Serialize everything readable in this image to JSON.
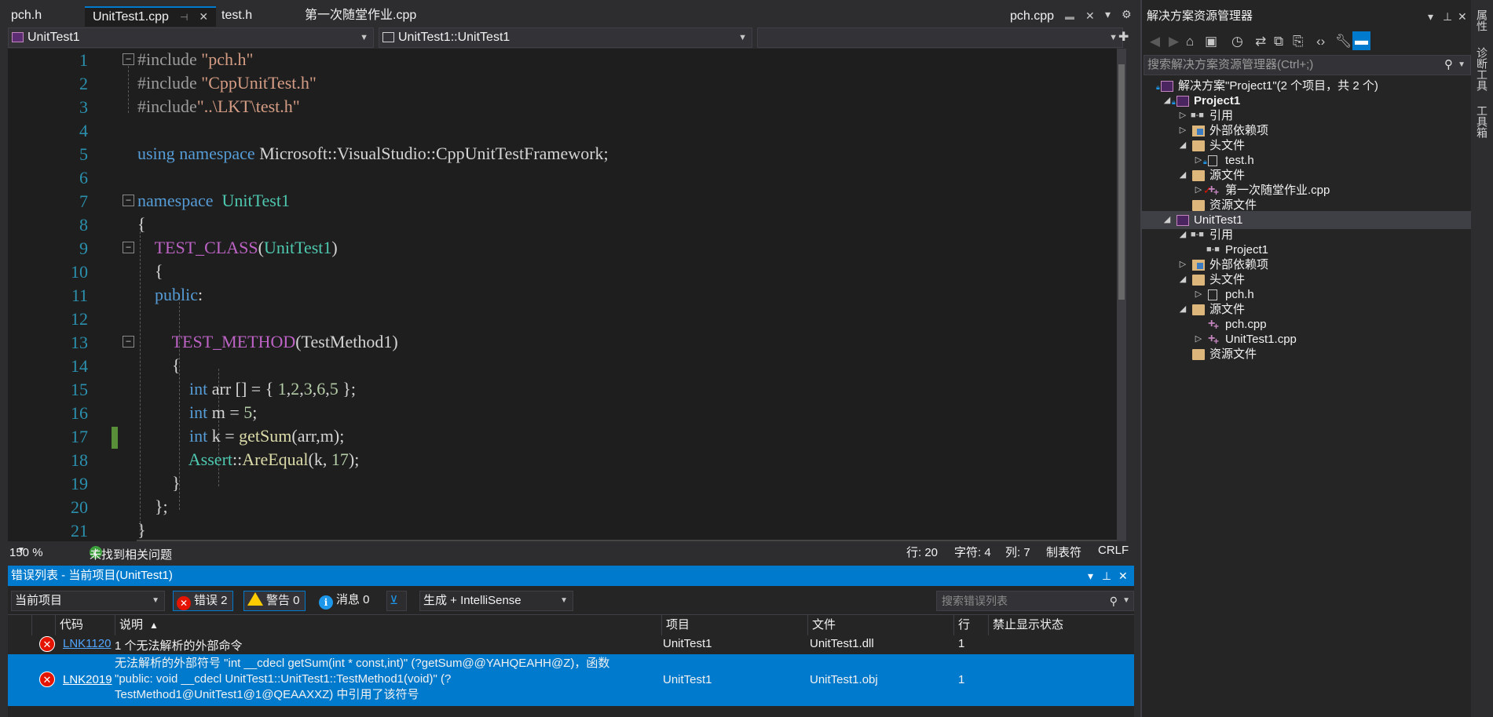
{
  "tabs": [
    {
      "label": "pch.h",
      "active": false
    },
    {
      "label": "UnitTest1.cpp",
      "active": true
    },
    {
      "label": "test.h",
      "active": false
    },
    {
      "label": "第一次随堂作业.cpp",
      "active": false
    },
    {
      "label": "pch.cpp",
      "active": false
    }
  ],
  "navbar": {
    "project": "UnitTest1",
    "scope": "UnitTest1::UnitTest1",
    "member": ""
  },
  "editor": {
    "line_numbers": [
      "1",
      "2",
      "3",
      "4",
      "5",
      "6",
      "7",
      "8",
      "9",
      "10",
      "11",
      "12",
      "13",
      "14",
      "15",
      "16",
      "17",
      "18",
      "19",
      "20",
      "21"
    ],
    "lines": [
      "#include \"pch.h\"",
      "#include \"CppUnitTest.h\"",
      "#include\"..\\LKT\\test.h\"",
      "",
      "using namespace Microsoft::VisualStudio::CppUnitTestFramework;",
      "",
      "namespace  UnitTest1",
      "{",
      "    TEST_CLASS(UnitTest1)",
      "    {",
      "    public:",
      "",
      "        TEST_METHOD(TestMethod1)",
      "        {",
      "            int arr [] = { 1,2,3,6,5 };",
      "            int m = 5;",
      "            int k = getSum(arr,m);",
      "            Assert::AreEqual(k, 17);",
      "        }",
      "    };",
      "}"
    ]
  },
  "editor_status": {
    "zoom": "150 %",
    "issues": "未找到相关问题",
    "line": "行: 20",
    "char": "字符: 4",
    "col": "列: 7",
    "indent": "制表符",
    "eol": "CRLF"
  },
  "error_list": {
    "title": "错误列表 - 当前项目(UnitTest1)",
    "scope": "当前项目",
    "errors_label": "错误 2",
    "warnings_label": "警告 0",
    "messages_label": "消息 0",
    "build_filter": "生成 + IntelliSense",
    "search_placeholder": "搜索错误列表",
    "columns": {
      "code": "代码",
      "description": "说明",
      "project": "项目",
      "file": "文件",
      "line": "行",
      "suppression": "禁止显示状态"
    },
    "rows": [
      {
        "code": "LNK1120",
        "description": "1 个无法解析的外部命令",
        "project": "UnitTest1",
        "file": "UnitTest1.dll",
        "line": "1"
      },
      {
        "code": "LNK2019",
        "description": "无法解析的外部符号 \"int __cdecl getSum(int * const,int)\" (?getSum@@YAHQEAHH@Z)，函数\n\"public: void __cdecl UnitTest1::UnitTest1::TestMethod1(void)\" (?\nTestMethod1@UnitTest1@1@QEAAXXZ) 中引用了该符号",
        "project": "UnitTest1",
        "file": "UnitTest1.obj",
        "line": "1"
      }
    ]
  },
  "solution_explorer": {
    "title": "解决方案资源管理器",
    "search_placeholder": "搜索解决方案资源管理器(Ctrl+;)",
    "nodes": [
      {
        "label": "解决方案\"Project1\"(2 个项目，共 2 个)",
        "depth": 0,
        "icon": "solution",
        "expand": ""
      },
      {
        "label": "Project1",
        "depth": 1,
        "icon": "project",
        "expand": "open",
        "bold": true
      },
      {
        "label": "引用",
        "depth": 2,
        "icon": "ref",
        "expand": "closed"
      },
      {
        "label": "外部依赖项",
        "depth": 2,
        "icon": "ext",
        "expand": "closed"
      },
      {
        "label": "头文件",
        "depth": 2,
        "icon": "folder",
        "expand": "open"
      },
      {
        "label": "test.h",
        "depth": 3,
        "icon": "h",
        "expand": "closed"
      },
      {
        "label": "源文件",
        "depth": 2,
        "icon": "folder",
        "expand": "open"
      },
      {
        "label": "第一次随堂作业.cpp",
        "depth": 3,
        "icon": "cpp",
        "expand": "closed"
      },
      {
        "label": "资源文件",
        "depth": 2,
        "icon": "folder",
        "expand": ""
      },
      {
        "label": "UnitTest1",
        "depth": 1,
        "icon": "project",
        "expand": "open",
        "selected": true
      },
      {
        "label": "引用",
        "depth": 2,
        "icon": "ref",
        "expand": "open"
      },
      {
        "label": "Project1",
        "depth": 3,
        "icon": "ref",
        "expand": ""
      },
      {
        "label": "外部依赖项",
        "depth": 2,
        "icon": "ext",
        "expand": "closed"
      },
      {
        "label": "头文件",
        "depth": 2,
        "icon": "folder",
        "expand": "open"
      },
      {
        "label": "pch.h",
        "depth": 3,
        "icon": "h",
        "expand": "closed"
      },
      {
        "label": "源文件",
        "depth": 2,
        "icon": "folder",
        "expand": "open"
      },
      {
        "label": "pch.cpp",
        "depth": 3,
        "icon": "cpp",
        "expand": ""
      },
      {
        "label": "UnitTest1.cpp",
        "depth": 3,
        "icon": "cpp",
        "expand": "closed"
      },
      {
        "label": "资源文件",
        "depth": 2,
        "icon": "folder",
        "expand": ""
      }
    ]
  },
  "side_strip": [
    "属性",
    "诊断工具",
    "工具箱"
  ],
  "colors": {
    "accent": "#007acc",
    "editor_bg": "#1e1e1e",
    "error_red": "#e51400",
    "warning_yellow": "#ffcc00",
    "keyword": "#569cd6",
    "string": "#d69d85",
    "macro": "#bd63c5",
    "type": "#4ec9b0"
  }
}
